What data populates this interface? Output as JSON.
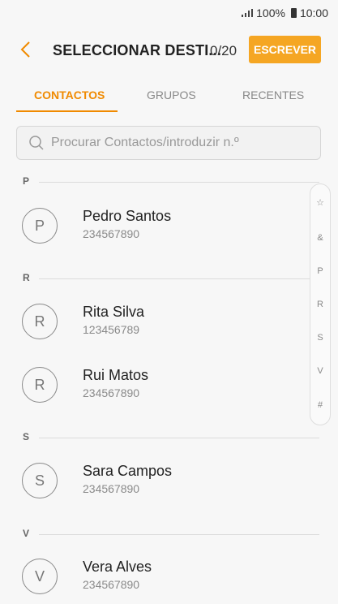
{
  "status": {
    "battery": "100%",
    "time": "10:00"
  },
  "appbar": {
    "title": "SELECCIONAR DESTI...",
    "count": "0/20",
    "write_label": "ESCREVER"
  },
  "tabs": [
    "CONTACTOS",
    "GRUPOS",
    "RECENTES"
  ],
  "search": {
    "placeholder": "Procurar Contactos/introduzir n.º"
  },
  "sections": [
    {
      "letter": "P",
      "contacts": [
        {
          "initial": "P",
          "name": "Pedro Santos",
          "number": "234567890"
        }
      ]
    },
    {
      "letter": "R",
      "contacts": [
        {
          "initial": "R",
          "name": "Rita Silva",
          "number": "123456789"
        },
        {
          "initial": "R",
          "name": "Rui Matos",
          "number": "234567890"
        }
      ]
    },
    {
      "letter": "S",
      "contacts": [
        {
          "initial": "S",
          "name": "Sara Campos",
          "number": "234567890"
        }
      ]
    },
    {
      "letter": "V",
      "contacts": [
        {
          "initial": "V",
          "name": "Vera Alves",
          "number": "234567890"
        }
      ]
    }
  ],
  "index": [
    "☆",
    "&",
    "P",
    "R",
    "S",
    "V",
    "#"
  ],
  "colors": {
    "accent": "#f5a623",
    "accent_text": "#f08a00"
  }
}
